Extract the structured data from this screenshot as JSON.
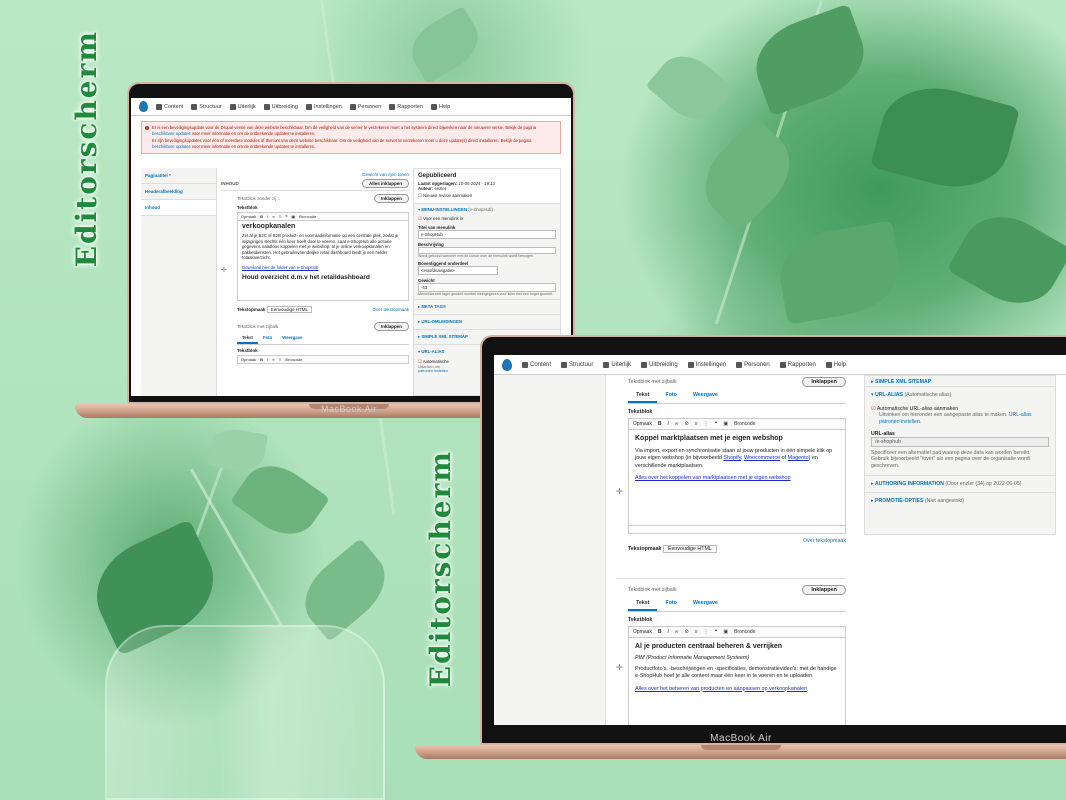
{
  "labels": {
    "editorscherm_1": "Editorscherm",
    "editorscherm_2": "Editorscherm"
  },
  "laptop_brand": "MacBook Air",
  "toolbar": {
    "items": [
      "Content",
      "Structuur",
      "Uiterlijk",
      "Uitbreiding",
      "Instellingen",
      "Personen",
      "Rapporten",
      "Help"
    ]
  },
  "messages": {
    "security_1": "Er is een beveiligingsupdate voor de Drupal-versie van deze website beschikbaar. Om de veiligheid van de server te verzekeren moet u het systeem direct bijwerken naar de nieuwere versie. Bekijk de pagina",
    "security_1_link": "beschikbare updates",
    "security_1_end": "voor meer informatie en om de ontbrekende updates te installeren.",
    "security_2": "Er zijn beveiligingsupdates voor één of meerdere modules of thema's van deze website beschikbaar. Om de veiligheid van de server te verzekeren moet u deze update(s) direct installeren. Bekijk de pagina",
    "security_2_link": "beschikbare updates",
    "security_2_end": "voor meer informatie en om de ontbrekende updates te installeren."
  },
  "screen1": {
    "side_tabs": [
      "Paginatitel",
      "Headerafbeelding",
      "Inhoud"
    ],
    "section_title": "INHOUD",
    "toggle_weights": "Gewicht van rijen tonen",
    "collapse_all": "Alles inklappen",
    "block1": {
      "label": "Tekstblok zonder zij...",
      "collapse": "Inklappen",
      "field_label": "Tekstblok",
      "format": "Opmaak",
      "source": "Broncode",
      "heading": "verkoopkanalen",
      "body": "Zet al je B2C of B2B product- en voorraadinformatie op een centrale plek, zodat je wijzigingen slechts één keer hoeft door te voeren. Laat e-ShopHub alle actuele gegevens naadloos koppelen met je webshop, al je online verkoopkanalen en pakketdiensten. Het gebruiksvriendelijke retail dashboard biedt je een helder totaaloverzicht.",
      "link": "Download hier de folder van e-ShopHub",
      "heading2": "Houd overzicht d.m.v het retaildashboard",
      "text_format_label": "Tekstopmaak",
      "text_format_value": "Eenvoudige HTML",
      "about_formats": "Over tekstopmaak"
    },
    "block2": {
      "label": "Tekstblok met zijbalk",
      "collapse": "Inklappen",
      "tabs": [
        "Tekst",
        "Foto",
        "Weergave"
      ],
      "field_label": "Tekstblok",
      "format": "Opmaak",
      "source": "Broncode"
    },
    "sidebar": {
      "status": "Gepubliceerd",
      "last_saved_label": "Laatst opgeslagen:",
      "last_saved_value": "10-05-2024 - 19:13",
      "author_label": "Auteur:",
      "author_value": "enzler",
      "new_revision": "Nieuwe revisie aanmaken",
      "menu_section": "MENU-INSTELLINGEN",
      "menu_section_note": "(e-ShopHub)",
      "provide_menu_link": "Voor een menulink in",
      "menu_title_label": "Titel van menulink",
      "menu_title_value": "e-ShopHub",
      "description_label": "Beschrijving",
      "description_hint": "Wordt getoond wanneer met de cursor over de menulink wordt bewogen.",
      "parent_label": "Bovenliggend onderdeel",
      "parent_value": "<Hoofdnavigatie>",
      "weight_label": "Gewicht",
      "weight_value": "-43",
      "weight_hint": "Menulinks met lager gewicht worden weergegeven voor links met een hoger gewicht.",
      "sections": [
        "META TAGS",
        "URL-OMLEIDINGEN",
        "SIMPLE XML SITEMAP",
        "URL-ALIAS"
      ],
      "auto_alias": "Automatische",
      "auto_alias_hint": "Uitvinken om",
      "alias_patterns": "patronen instellen"
    }
  },
  "screen2": {
    "block_top": {
      "label": "Tekstblok met zijbalk",
      "collapse": "Inklappen",
      "tabs": [
        "Tekst",
        "Foto",
        "Weergave"
      ],
      "field_label": "Tekstblok",
      "format": "Opmaak",
      "source": "Broncode",
      "heading": "Koppel marktplaatsen met je eigen webshop",
      "body_1": "Via import, export en synchronisatie staan al jouw producten in één simpele klik op jouw eigen webshop (in bijvoorbeeld",
      "shopify": "Shopify",
      "woocommerce": "Woocommerce",
      "of": "of",
      "magento": "Magento",
      "body_2": ") en verschillende marktplaatsen.",
      "link": "Alles over het koppelen van marktplaatsen met je eigen webshop",
      "about_formats": "Over tekstopmaak",
      "text_format_label": "Tekstopmaak",
      "text_format_value": "Eenvoudige HTML"
    },
    "block_bottom": {
      "label": "Tekstblok met zijbalk",
      "collapse": "Inklappen",
      "tabs": [
        "Tekst",
        "Foto",
        "Weergave"
      ],
      "field_label": "Tekstblok",
      "format": "Opmaak",
      "source": "Broncode",
      "heading": "Al je producten centraal beheren & verrijken",
      "subheading": "PIM (Product Informatie Management Systeem)",
      "body": "Productfoto's, -beschrijvingen en -specificaties, demonstratievideo's: met de handige e-ShopHub hoef je alle content maar één keer in te voeren en te uploaden.",
      "link": "Alles over het beheren van producten en aanpassen op verkoopkanalen"
    },
    "sidebar": {
      "top_section": "SIMPLE XML SITEMAP",
      "url_alias": "URL-ALIAS",
      "url_alias_note": "(Automatische alias)",
      "auto_alias": "Automatische URL-alias aanmaken",
      "auto_alias_hint": "Uitvinken om hieronder een aangepaste alias te maken.",
      "alias_patterns": "URL-alias patronen instellen.",
      "alias_label": "URL-alias",
      "alias_value": "/e-shophub",
      "alias_hint": "Specificeer een alternatief pad waarop deze data kan worden bereikt. Gebruik bijvoorbeeld \"/over\" als een pagina over de organisatie wordt geschreven.",
      "authoring": "AUTHORING INFORMATION",
      "authoring_note": "(Door enzler (34) op 2022-06-05)",
      "promotion": "PROMOTIE-OPTIES",
      "promotion_note": "(Niet aangevinkt)"
    }
  }
}
